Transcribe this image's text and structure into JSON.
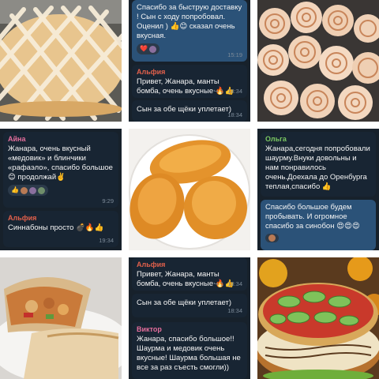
{
  "colors": {
    "chat_bg": "#17212b",
    "bubble_in": "#182533",
    "bubble_out": "#2b5278",
    "name_pink": "#e56e9c",
    "name_green": "#7bc862",
    "name_red": "#e1604b",
    "time": "#7d8b99"
  },
  "tile_top_center": {
    "msg1": "Спасибо за быструю доставку ! Сын с ходу попробовал. Оценил ) 👍😊 сказал очень вкусная.",
    "msg1_reaction": "❤️",
    "msg1_time": "15:19",
    "msg2_sender": "Альфия",
    "msg2": "Привет, Жанара, манты бомба, очень вкусные 🔥👍",
    "msg2_views": "1",
    "msg2_time": "18:34",
    "msg3": "Сын за обе щёки уплетает)",
    "msg3_time": "18:34"
  },
  "tile_mid_left": {
    "msg1_sender": "Айна",
    "msg1": "Жанара, очень вкусный «медовик» и блинчики «рафаэло», спасибо большое 😊 продолжай✌️",
    "msg1_reaction": "👍",
    "msg1_time": "9:29",
    "msg2_sender": "Альфия",
    "msg2": "Синнабоны просто 💣🔥👍",
    "msg2_time": "19:34"
  },
  "tile_mid_right": {
    "msg1_sender": "Ольга",
    "msg1": "Жанара,сегодня попробовали шаурму.Внуки довольны и нам понравилось очень.Доехала до Оренбурга теплая,спасибо 👍",
    "msg2": "Спасибо большое будем пробывать. И огромное спасибо за синобон 😍😍😍"
  },
  "tile_bottom_center": {
    "msg1_sender": "Альфия",
    "msg1": "Привет, Жанара, манты бомба, очень вкусные 🔥👍",
    "msg1_views": "1",
    "msg1_time": "18:34",
    "msg2": "Сын за обе щёки уплетает)",
    "msg2_time": "18:34",
    "msg3_sender": "Виктор",
    "msg3": "Жанара, спасибо большое!! Шаурма и медовик очень вкусные! Шаурма большая не все за раз съесть смогли))"
  }
}
